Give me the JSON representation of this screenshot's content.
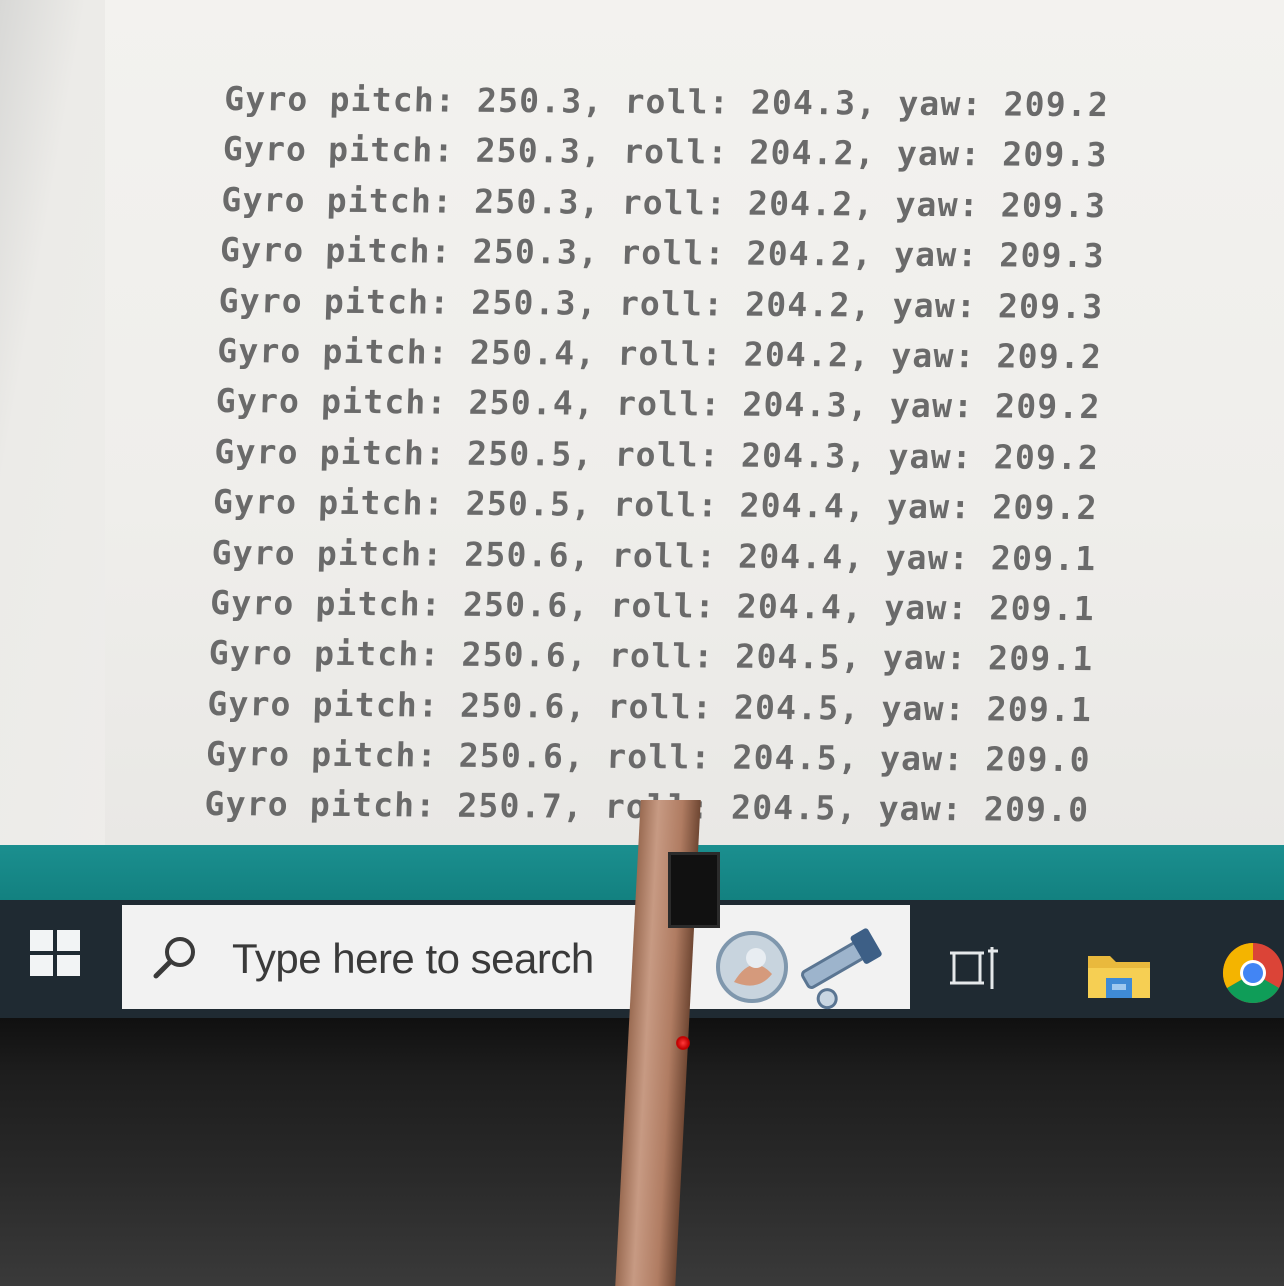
{
  "serial_monitor": {
    "lines": [
      "Gyro pitch: 250.3, roll: 204.3, yaw: 209.2",
      "Gyro pitch: 250.3, roll: 204.2, yaw: 209.3",
      "Gyro pitch: 250.3, roll: 204.2, yaw: 209.3",
      "Gyro pitch: 250.3, roll: 204.2, yaw: 209.3",
      "Gyro pitch: 250.3, roll: 204.2, yaw: 209.3",
      "Gyro pitch: 250.4, roll: 204.2, yaw: 209.2",
      "Gyro pitch: 250.4, roll: 204.3, yaw: 209.2",
      "Gyro pitch: 250.5, roll: 204.3, yaw: 209.2",
      "Gyro pitch: 250.5, roll: 204.4, yaw: 209.2",
      "Gyro pitch: 250.6, roll: 204.4, yaw: 209.1",
      "Gyro pitch: 250.6, roll: 204.4, yaw: 209.1",
      "Gyro pitch: 250.6, roll: 204.5, yaw: 209.1",
      "Gyro pitch: 250.6, roll: 204.5, yaw: 209.1",
      "Gyro pitch: 250.6, roll: 204.5, yaw: 209.0",
      "Gyro pitch: 250.7, roll: 204.5, yaw: 209.0"
    ]
  },
  "taskbar": {
    "search_placeholder": "Type here to search",
    "icons": [
      "windows-start-icon",
      "search-icon",
      "cortana-icon",
      "task-view-icon",
      "file-explorer-icon",
      "chrome-icon"
    ]
  },
  "colors": {
    "teal_bar": "#12807f",
    "taskbar_bg": "#1f2a32",
    "log_text": "#6a6a6a"
  }
}
